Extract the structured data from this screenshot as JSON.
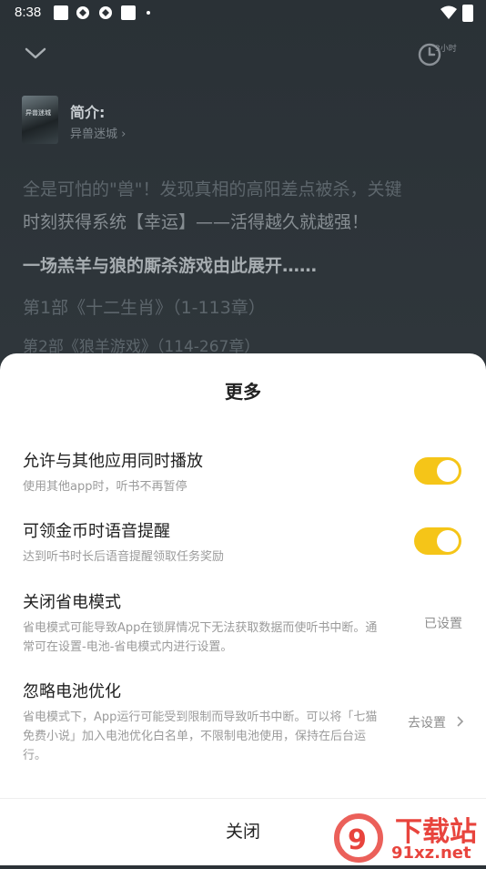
{
  "status_bar": {
    "time": "8:38"
  },
  "player": {
    "timer_label": "3小时",
    "intro_title": "简介:",
    "book_name": "异兽迷城",
    "cover_text": "异兽迷城"
  },
  "background_text": {
    "line1": "全是可怕的\"兽\"！发现真相的高阳差点被杀，关键",
    "line2": "时刻获得系统【幸运】——活得越久就越强！",
    "line3": "一场羔羊与狼的厮杀游戏由此展开……",
    "line4": "第1部《十二生肖》（1-113章）",
    "line5": "第2部《狼羊游戏》（114-267章）"
  },
  "sheet": {
    "title": "更多",
    "items": [
      {
        "title": "允许与其他应用同时播放",
        "desc": "使用其他app时，听书不再暂停",
        "toggle": true
      },
      {
        "title": "可领金币时语音提醒",
        "desc": "达到听书时长后语音提醒领取任务奖励",
        "toggle": true
      },
      {
        "title": "关闭省电模式",
        "desc": "省电模式可能导致App在锁屏情况下无法获取数据而使听书中断。通常可在设置-电池-省电模式内进行设置。",
        "status": "已设置"
      },
      {
        "title": "忽略电池优化",
        "desc": "省电模式下，App运行可能受到限制而导致听书中断。可以将「七猫免费小说」加入电池优化白名单，不限制电池使用，保持在后台运行。",
        "status": "去设置"
      }
    ],
    "close_label": "关闭"
  },
  "watermark": {
    "text1": "下载站",
    "text2": "91xz.net"
  },
  "colors": {
    "accent": "#f5c518",
    "background": "#2c3237",
    "sheet": "#ffffff"
  }
}
